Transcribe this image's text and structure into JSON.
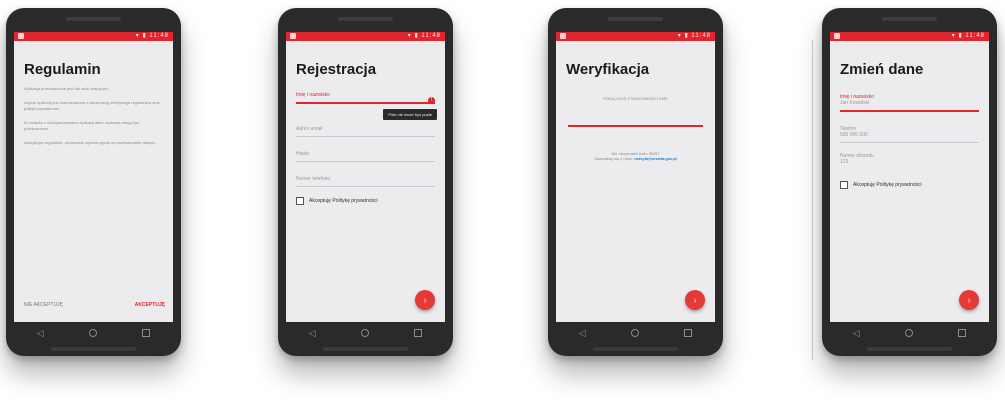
{
  "colors": {
    "accent": "#e0262d",
    "link": "#1a7fd1",
    "screen_bg": "#ececef"
  },
  "status_bar": {
    "time": "▾ ▮ 11:48"
  },
  "screens": {
    "terms": {
      "title": "Regulamin",
      "paragraphs": [
        "Aplikacja przeznaczona jest dla osób płacących.",
        "Użycie aplikacji jest równoznaczne z akceptacją niniejszego regulaminu oraz polityki prywatności.",
        "W związku z funkcjonowaniem aplikacji dane osobowe mogą być przetwarzane.",
        "Akceptując regulamin, użytkownik wyraża zgodę na przetwarzanie danych."
      ],
      "footer_left": "NIE AKCEPTUJĘ",
      "accept_label": "AKCEPTUJĘ"
    },
    "register": {
      "title": "Rejestracja",
      "field_name_label": "Imię i nazwisko",
      "tooltip": "Pole nie może być puste",
      "field_email_label": "Adres email",
      "field_password_label": "Hasło",
      "field_phone_label": "Numer telefonu",
      "privacy_checkbox_label": "Akceptuję Politykę prywatności",
      "fab_icon": "arrow-right-icon"
    },
    "verify": {
      "title": "Weryfikacja",
      "instruction": "PODAJ KOD Z WIADOMOŚCI SMS",
      "help_line1": "Nie otrzymałeś kodu SMS?",
      "help_line2": "Skontaktuj się z nami:",
      "help_email": "rozsyla@mswia.gov.pl",
      "fab_icon": "arrow-right-icon"
    },
    "edit": {
      "title": "Zmień dane",
      "field_name_label": "Imię i nazwisko",
      "field_name_value": "Jan Kowalski",
      "field_phone_label": "Telefon",
      "field_phone_value": "500 000 000",
      "field_district_label": "Numer obwodu",
      "field_district_value": "123",
      "privacy_checkbox_label": "Akceptuję Politykę prywatności",
      "fab_icon": "arrow-right-icon"
    }
  },
  "nav": {
    "back": "◁",
    "home": "○",
    "recent": "□"
  }
}
